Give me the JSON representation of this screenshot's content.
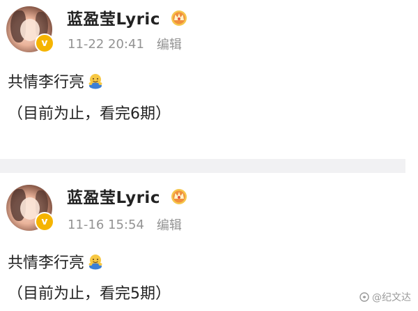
{
  "posts": [
    {
      "username": "蓝盈莹Lyric",
      "timestamp": "11-22 20:41",
      "edit_label": "编辑",
      "text_line1": "共情李行亮",
      "text_line2": "（目前为止，看完6期）",
      "avatar_badge": "v",
      "icons": [
        "avatar",
        "verified-badge-icon",
        "crown-icon",
        "hug-emoji-icon"
      ]
    },
    {
      "username": "蓝盈莹Lyric",
      "timestamp": "11-16 15:54",
      "edit_label": "编辑",
      "text_line1": "共情李行亮",
      "text_line2": "（目前为止，看完5期）",
      "avatar_badge": "v",
      "icons": [
        "avatar",
        "verified-badge-icon",
        "crown-icon",
        "hug-emoji-icon"
      ]
    }
  ],
  "watermark": {
    "text": "@纪文达",
    "icon": "watermark-logo-icon"
  },
  "colors": {
    "text": "#222222",
    "meta": "#939393",
    "verified_badge": "#f5b400",
    "divider": "#f1f1f3"
  }
}
